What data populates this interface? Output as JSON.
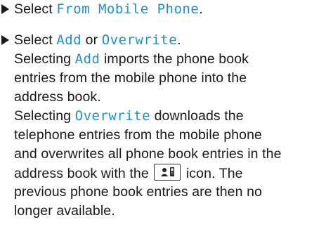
{
  "steps": [
    {
      "line1_before": "Select ",
      "line1_key": "From Mobile Phone",
      "line1_after": "."
    },
    {
      "line1_before": "Select ",
      "line1_key1": "Add",
      "line1_middle": " or ",
      "line1_key2": "Overwrite",
      "line1_after": "."
    }
  ],
  "para1": {
    "l1_before": "Selecting ",
    "l1_key": "Add",
    "l1_after": " imports the phone book",
    "l2": "entries from the mobile phone into the",
    "l3": "address book."
  },
  "para2": {
    "l1_before": "Selecting ",
    "l1_key": "Overwrite",
    "l1_after": " downloads the",
    "l2": "telephone entries from the mobile phone",
    "l3": "and overwrites all phone book entries in the",
    "l4_before": "address book with the ",
    "l4_icon": "phone-book-entry-icon",
    "l4_after": " icon. The",
    "l5": "previous phone book entries are then no",
    "l6": "longer available."
  },
  "colors": {
    "key_text": "#1f8fcc",
    "body_text": "#1a1a1a"
  }
}
